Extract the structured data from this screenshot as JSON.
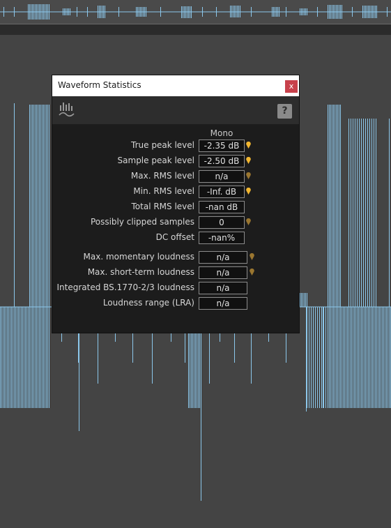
{
  "colors": {
    "waveform": "#8cc8ec",
    "marker_active": "#f2b630",
    "marker_inactive": "#9a7630",
    "close": "#c8414b"
  },
  "dialog": {
    "title": "Waveform Statistics",
    "close_label": "x",
    "help_label": "?",
    "stats_icon": "waveform-statistics-icon",
    "column_header": "Mono",
    "rows": [
      {
        "label": "True peak level",
        "value": "-2.35 dB",
        "marker": "active"
      },
      {
        "label": "Sample peak level",
        "value": "-2.50 dB",
        "marker": "active"
      },
      {
        "label": "Max. RMS level",
        "value": "n/a",
        "marker": "inactive"
      },
      {
        "label": "Min. RMS level",
        "value": "-Inf. dB",
        "marker": "active"
      },
      {
        "label": "Total RMS level",
        "value": "-nan dB",
        "marker": "none"
      },
      {
        "label": "Possibly clipped samples",
        "value": "0",
        "marker": "inactive"
      },
      {
        "label": "DC offset",
        "value": "-nan%",
        "marker": "none"
      }
    ],
    "loudness_rows": [
      {
        "label": "Max. momentary loudness",
        "value": "n/a",
        "marker": "inactive"
      },
      {
        "label": "Max. short-term loudness",
        "value": "n/a",
        "marker": "inactive"
      },
      {
        "label": "Integrated BS.1770-2/3 loudness",
        "value": "n/a",
        "marker": "none"
      },
      {
        "label": "Loudness range (LRA)",
        "value": "n/a",
        "marker": "none"
      }
    ]
  }
}
